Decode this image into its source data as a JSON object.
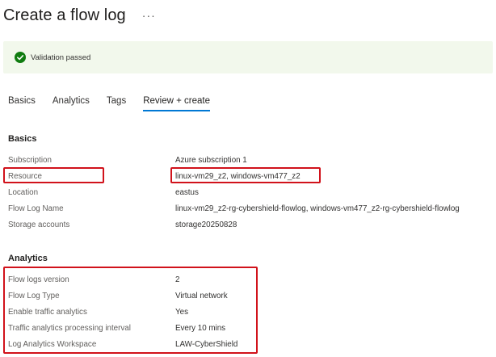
{
  "header": {
    "title": "Create a flow log",
    "more": "···"
  },
  "validation": {
    "text": "Validation passed",
    "status_color": "#107c10"
  },
  "tabs": [
    {
      "label": "Basics",
      "active": false
    },
    {
      "label": "Analytics",
      "active": false
    },
    {
      "label": "Tags",
      "active": false
    },
    {
      "label": "Review + create",
      "active": true
    }
  ],
  "basics": {
    "title": "Basics",
    "rows": [
      {
        "label": "Subscription",
        "value": "Azure subscription 1"
      },
      {
        "label": "Resource",
        "value": "linux-vm29_z2, windows-vm477_z2"
      },
      {
        "label": "Location",
        "value": "eastus"
      },
      {
        "label": "Flow Log Name",
        "value": "linux-vm29_z2-rg-cybershield-flowlog, windows-vm477_z2-rg-cybershield-flowlog"
      },
      {
        "label": "Storage accounts",
        "value": "storage20250828"
      }
    ]
  },
  "analytics": {
    "title": "Analytics",
    "rows": [
      {
        "label": "Flow logs version",
        "value": "2"
      },
      {
        "label": "Flow Log Type",
        "value": "Virtual network"
      },
      {
        "label": "Enable traffic analytics",
        "value": "Yes"
      },
      {
        "label": "Traffic analytics processing interval",
        "value": "Every 10 mins"
      },
      {
        "label": "Log Analytics Workspace",
        "value": "LAW-CyberShield"
      }
    ]
  },
  "colors": {
    "accent": "#0078d4",
    "highlight": "#d1121b",
    "banner_bg": "#f2f8ec"
  }
}
